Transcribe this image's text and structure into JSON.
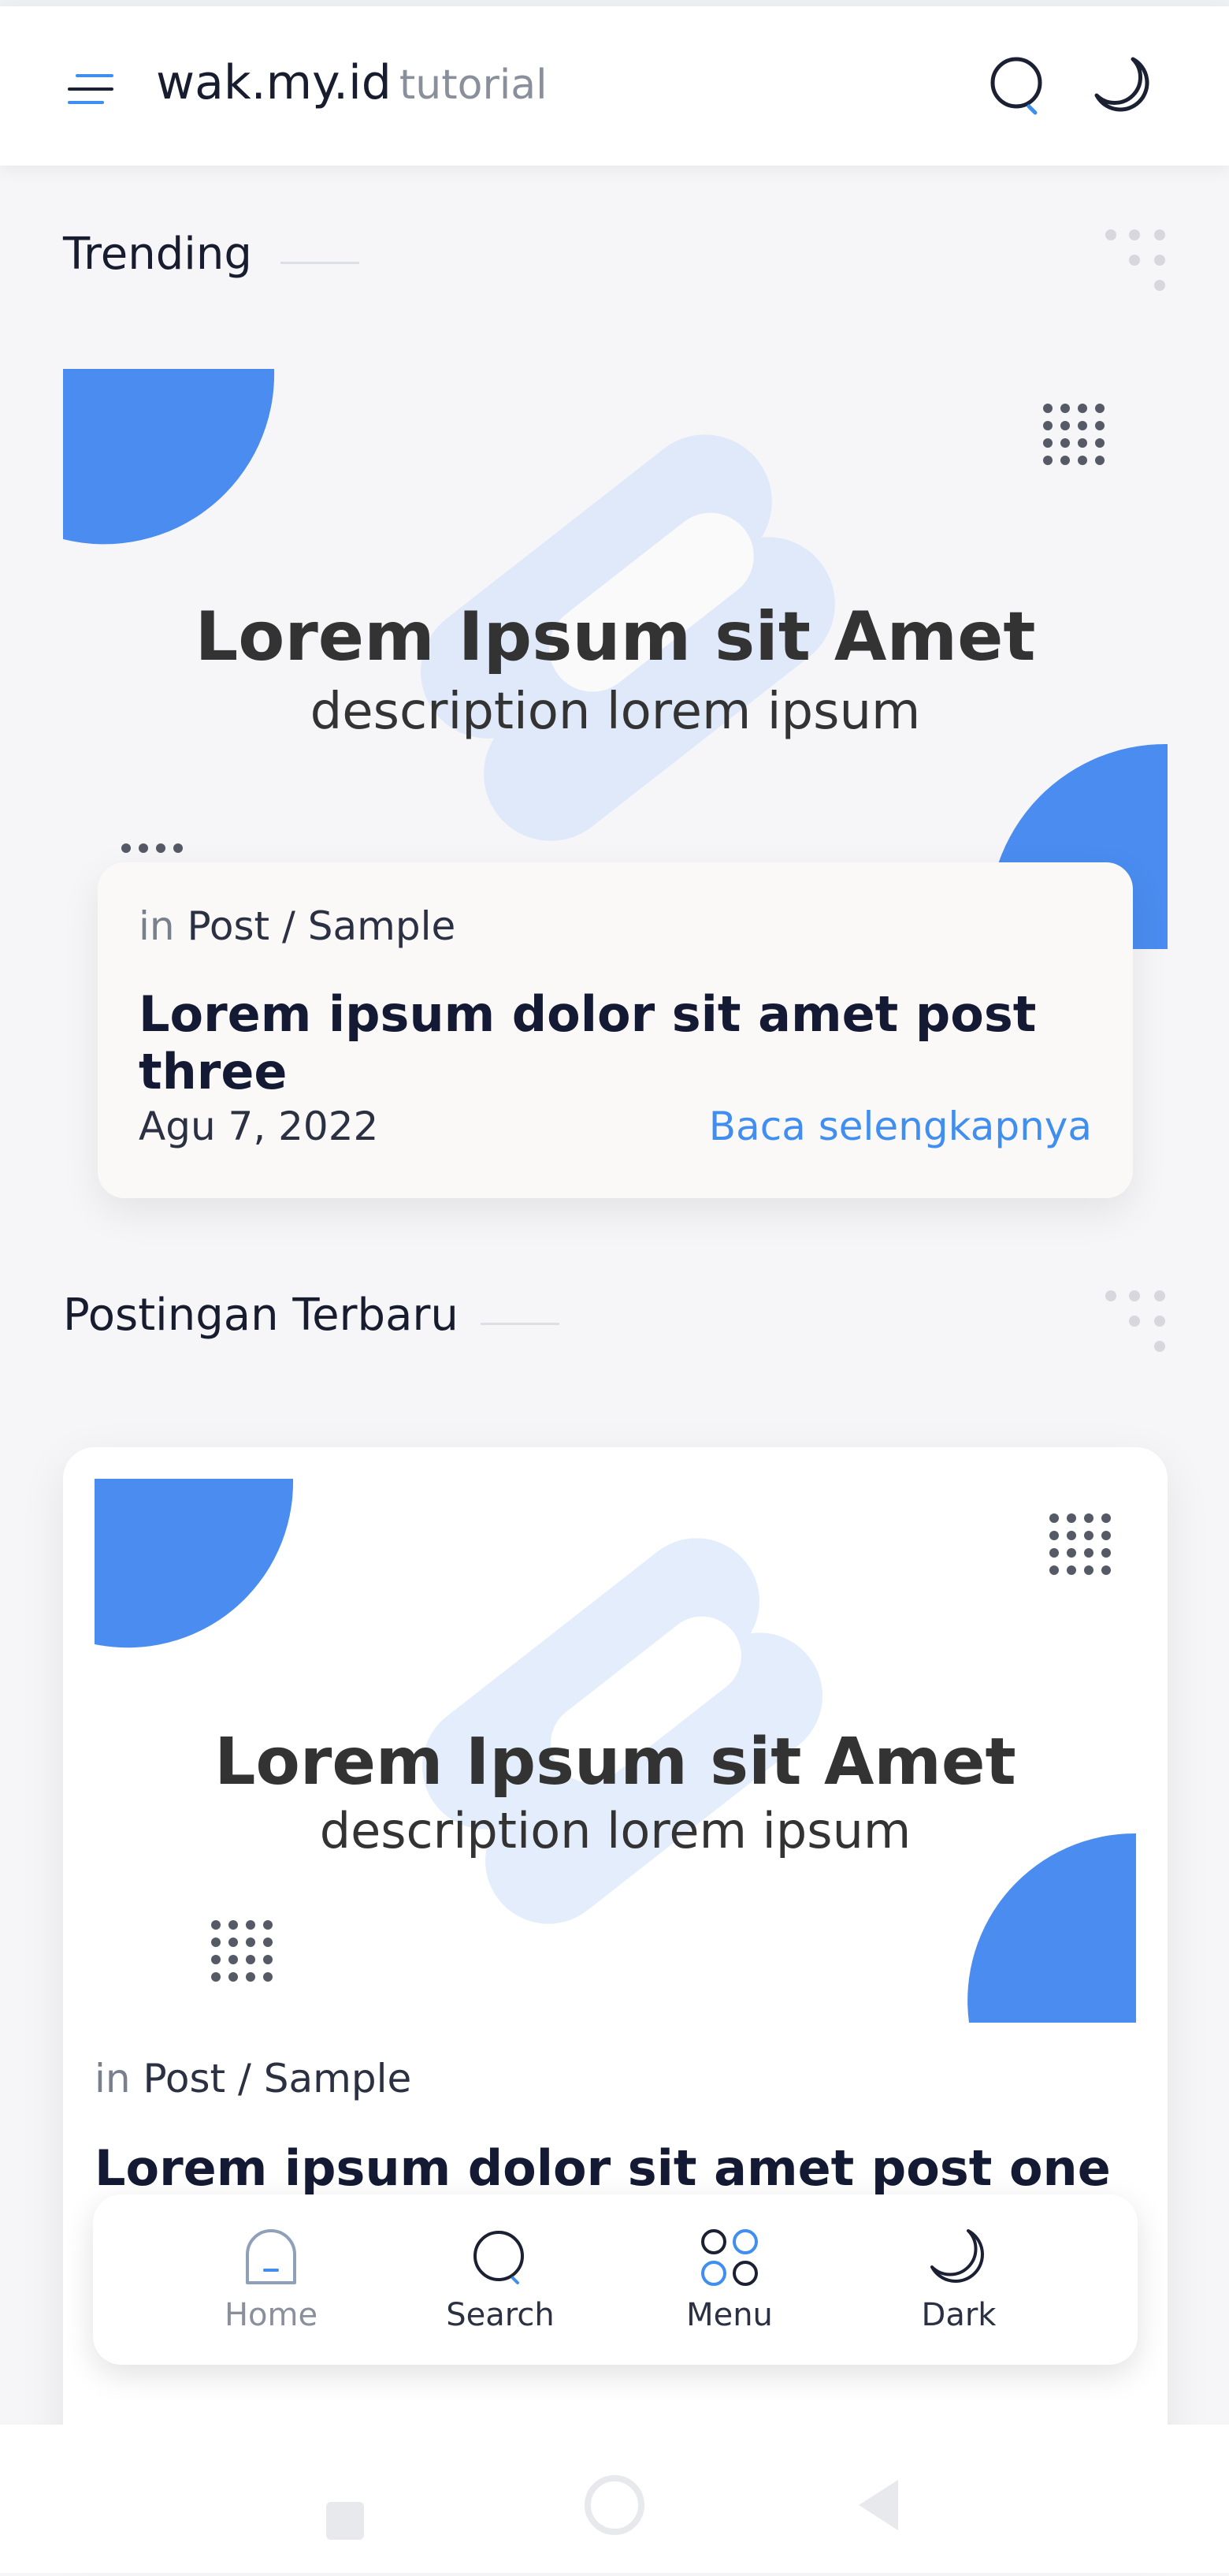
{
  "header": {
    "brand": "wak.my.id",
    "brand_sub": "tutorial"
  },
  "sections": {
    "trending": "Trending",
    "latest": "Postingan Terbaru"
  },
  "thumbnail": {
    "title": "Lorem Ipsum sit Amet",
    "description": "description lorem ipsum"
  },
  "trending_post": {
    "in": "in",
    "category": "Post / Sample",
    "title": "Lorem ipsum dolor sit amet post three",
    "date": "Agu 7, 2022",
    "read_more": "Baca selengkapnya"
  },
  "latest_post": {
    "in": "in",
    "category": "Post / Sample",
    "title": "Lorem ipsum dolor sit amet post one"
  },
  "bottom_nav": {
    "home": "Home",
    "search": "Search",
    "menu": "Menu",
    "dark": "Dark"
  },
  "colors": {
    "accent": "#3f8ef0",
    "blue_shape": "#4a8cf0",
    "text": "#171c2e"
  }
}
